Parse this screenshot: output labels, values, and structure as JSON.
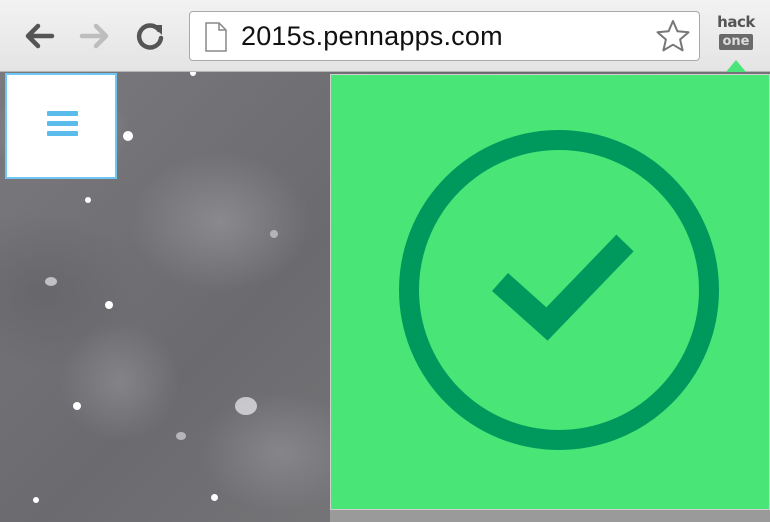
{
  "browser": {
    "url": "2015s.pennapps.com",
    "extension_top_text": "hack",
    "extension_bottom_text": "one",
    "icons": {
      "back": "back-arrow-icon",
      "forward": "forward-arrow-icon",
      "reload": "reload-icon",
      "page": "page-icon",
      "bookmark": "star-icon"
    }
  },
  "page": {
    "menu_icon": "hamburger-menu-icon"
  },
  "popup": {
    "status_icon": "check-circle-icon",
    "colors": {
      "background": "#49e577",
      "icon": "#00995d"
    }
  }
}
